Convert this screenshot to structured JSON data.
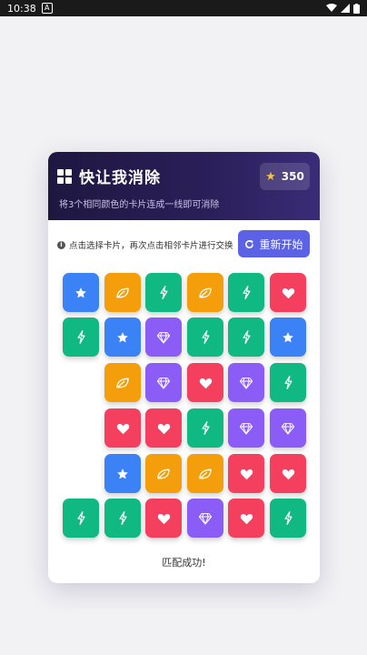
{
  "status_bar": {
    "time": "10:38",
    "notif_badge": "A"
  },
  "header": {
    "title": "快让我消除",
    "subtitle": "将3个相同颜色的卡片连成一线即可消除",
    "score": "350",
    "colors": {
      "background_start": "#1e1740",
      "background_end": "#3a2c78",
      "star": "#f7c23e"
    }
  },
  "toolbar": {
    "hint": "点击选择卡片，再次点击相邻卡片进行交换",
    "restart_label": "重新开始",
    "restart_color": "#5b62e6"
  },
  "board": {
    "colors": {
      "blue": "#3b82f6",
      "orange": "#f59e0b",
      "green": "#10b981",
      "red": "#f43f5e",
      "purple": "#8b5cf6"
    },
    "icons": {
      "blue": "star-icon",
      "orange": "leaf-icon",
      "green": "bolt-icon",
      "red": "heart-icon",
      "purple": "diamond-icon"
    },
    "rows": [
      [
        "blue",
        "orange",
        "green",
        "orange",
        "green",
        "red"
      ],
      [
        "green",
        "blue",
        "purple",
        "green",
        "green",
        "blue"
      ],
      [
        null,
        "orange",
        "purple",
        "red",
        "purple",
        "green"
      ],
      [
        null,
        "red",
        "red",
        "green",
        "purple",
        "purple"
      ],
      [
        null,
        "blue",
        "orange",
        "orange",
        "red",
        "red"
      ],
      [
        "green",
        "green",
        "red",
        "purple",
        "red",
        "green"
      ]
    ]
  },
  "footer": {
    "message": "匹配成功!"
  }
}
